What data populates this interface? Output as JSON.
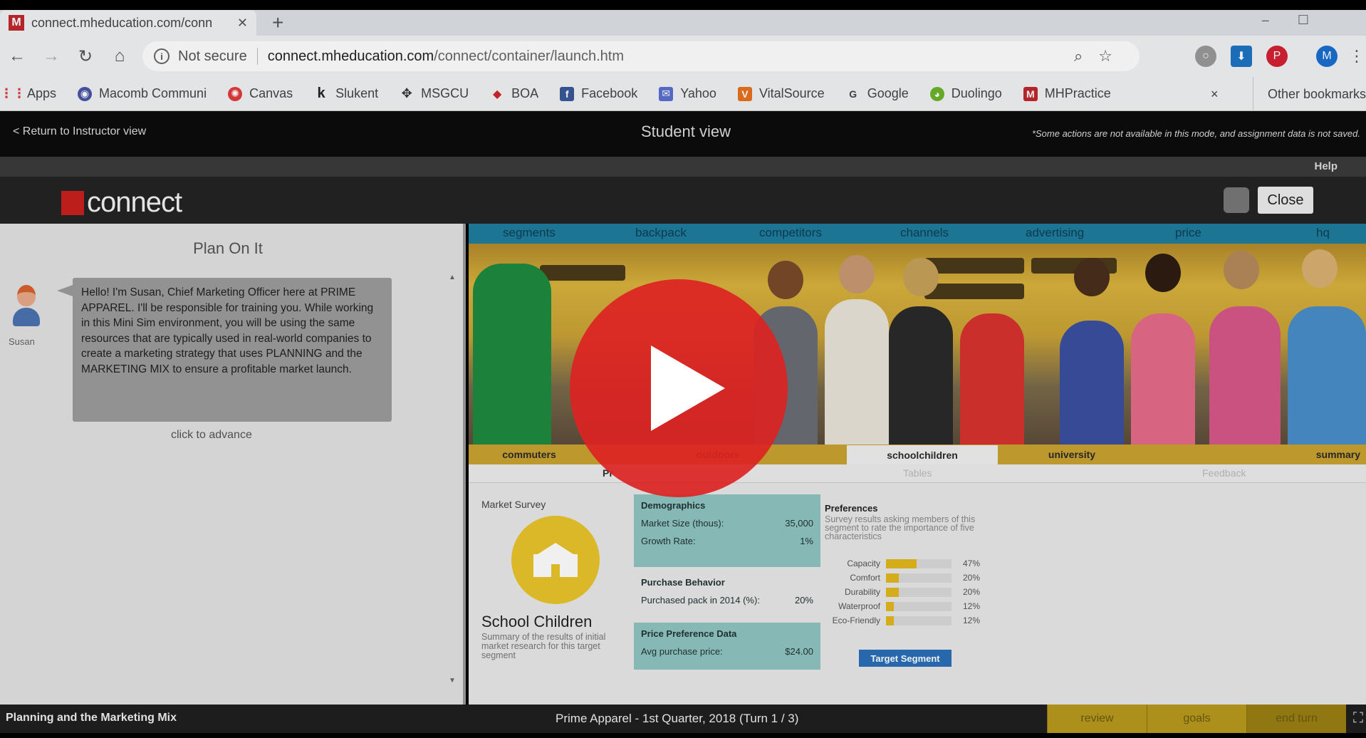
{
  "browser": {
    "tab_title": "connect.mheducation.com/conn",
    "tab_favicon": "M",
    "address": {
      "security": "Not secure",
      "host": "connect.mheducation.com",
      "path": "/connect/container/launch.htm"
    },
    "bookmarks": [
      {
        "label": "Apps",
        "icon": "apps-grid-icon",
        "color": "#555555"
      },
      {
        "label": "Macomb Communi",
        "icon": "macomb-icon",
        "color": "#4a56a6"
      },
      {
        "label": "Canvas",
        "icon": "canvas-icon",
        "color": "#e13b3b"
      },
      {
        "label": "Slukent",
        "icon": "k-icon",
        "color": "#222222"
      },
      {
        "label": "MSGCU",
        "icon": "msgcu-icon",
        "color": "#333333"
      },
      {
        "label": "BOA",
        "icon": "boa-icon",
        "color": "#d0262d"
      },
      {
        "label": "Facebook",
        "icon": "facebook-icon",
        "color": "#3b5998"
      },
      {
        "label": "Yahoo",
        "icon": "mail-icon",
        "color": "#5a6fd1"
      },
      {
        "label": "VitalSource",
        "icon": "vitalsource-icon",
        "color": "#e8721f"
      },
      {
        "label": "Google",
        "icon": "google-icon",
        "color": "#444444"
      },
      {
        "label": "Duolingo",
        "icon": "duolingo-icon",
        "color": "#6bb52a"
      },
      {
        "label": "MHPractice",
        "icon": "mhpractice-icon",
        "color": "#c0282d"
      }
    ],
    "bookmarks_close": "×",
    "other_bookmarks": "Other bookmarks"
  },
  "student_bar": {
    "return_link": "< Return to Instructor view",
    "title": "Student view",
    "notice": "*Some actions are not available in this mode, and assignment data is not saved."
  },
  "help": "Help",
  "connect": {
    "logo": "connect",
    "close": "Close"
  },
  "left": {
    "title": "Plan On It",
    "avatar_name": "Susan",
    "message": "Hello! I'm Susan, Chief Marketing Officer here at PRIME APPAREL. I'll be responsible for training you. While working in this Mini Sim environment, you will be using the same resources that are typically used in real-world companies to create a marketing strategy that uses PLANNING and the MARKETING MIX to ensure a profitable market launch.",
    "advance": "click to advance"
  },
  "nav": [
    "segments",
    "backpack",
    "competitors",
    "channels",
    "advertising",
    "price",
    "hq"
  ],
  "segment_tabs": [
    "commuters",
    "outdoors",
    "schoolchildren",
    "university",
    "summary"
  ],
  "subline": {
    "left": "Pr",
    "mid": "Tables",
    "right": "Feedback"
  },
  "market": {
    "label": "Market Survey",
    "segment": "School Children",
    "description": "Summary of the results of initial market research for this target segment"
  },
  "demographics": {
    "title": "Demographics",
    "rows": [
      {
        "label": "Market Size (thous):",
        "value": "35,000"
      },
      {
        "label": "Growth Rate:",
        "value": "1%"
      }
    ]
  },
  "purchase": {
    "title": "Purchase Behavior",
    "rows": [
      {
        "label": "Purchased pack in 2014 (%):",
        "value": "20%"
      }
    ]
  },
  "price_pref": {
    "title": "Price Preference Data",
    "rows": [
      {
        "label": "Avg purchase price:",
        "value": "$24.00"
      }
    ]
  },
  "preferences": {
    "title": "Preferences",
    "description": "Survey results asking members of this segment to rate the importance of five characteristics",
    "items": [
      {
        "label": "Capacity",
        "value": "47%",
        "fraction": 0.47
      },
      {
        "label": "Comfort",
        "value": "20%",
        "fraction": 0.2
      },
      {
        "label": "Durability",
        "value": "20%",
        "fraction": 0.2
      },
      {
        "label": "Waterproof",
        "value": "12%",
        "fraction": 0.12
      },
      {
        "label": "Eco-Friendly",
        "value": "12%",
        "fraction": 0.12
      }
    ],
    "button": "Target Segment"
  },
  "bottom": {
    "left": "Planning and the Marketing Mix",
    "center": "Prime Apparel - 1st Quarter, 2018 (Turn 1 / 3)",
    "buttons": [
      "review",
      "goals",
      "end turn"
    ]
  }
}
